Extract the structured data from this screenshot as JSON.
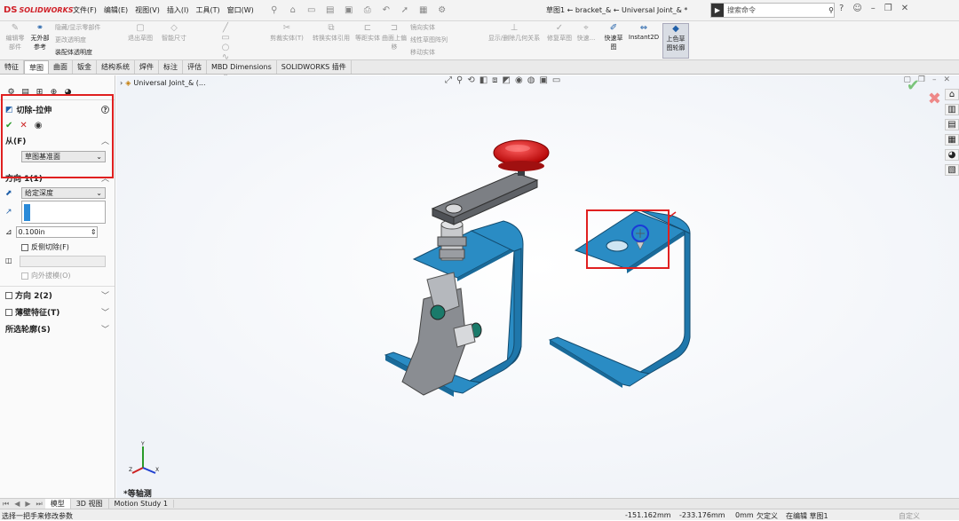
{
  "app": {
    "logo_mark": "DS",
    "logo_text": "SOLIDWORKS"
  },
  "menu": [
    "文件(F)",
    "编辑(E)",
    "视图(V)",
    "插入(I)",
    "工具(T)",
    "窗口(W)"
  ],
  "doc_title": "草图1 ← bracket_& ← Universal Joint_& *",
  "search": {
    "placeholder": "搜索命令"
  },
  "commands": {
    "edit_component": "编辑零部件",
    "no_external_refs": "无外部参考",
    "hide_show": "隐藏/显示零部件",
    "change_transparency": "更改透明度",
    "assembly_transparency": "装配体透明度",
    "exit_sketch": "退出草图",
    "smart_dimension": "智能尺寸",
    "trim_entities": "剪裁实体(T)",
    "convert_entities": "转换实体引用",
    "offset_entities": "等距实体",
    "surface_offset": "曲面上偏移",
    "mirror_entities": "镜向实体",
    "linear_pattern": "线性草图阵列",
    "move_entities": "移动实体",
    "display_relations": "显示/删除几何关系",
    "repair_sketch": "修复草图",
    "quick_snaps": "快速...",
    "rapid_sketch": "快速草图",
    "instant2d": "Instant2D",
    "shaded_contours": "上色草图轮廓"
  },
  "tabs": [
    "特征",
    "草图",
    "曲面",
    "钣金",
    "结构系统",
    "焊件",
    "标注",
    "评估",
    "MBD Dimensions",
    "SOLIDWORKS 插件"
  ],
  "active_tab": "草图",
  "property_manager": {
    "title": "切除-拉伸",
    "from_label": "从(F)",
    "from_value": "草图基准面",
    "direction1_label": "方向 1(1)",
    "end_condition": "给定深度",
    "depth": "0.100in",
    "flip_side": "反侧切除(F)",
    "draft_outward": "向外拔模(O)",
    "direction2_label": "方向 2(2)",
    "thin_feature_label": "薄壁特征(T)",
    "selected_contours_label": "所选轮廓(S)"
  },
  "tree": {
    "root": "Universal Joint_& (..."
  },
  "view": {
    "orientation_label": "*等轴测"
  },
  "bottom_tabs": [
    "模型",
    "3D 视图",
    "Motion Study 1"
  ],
  "status": {
    "message": "选择一把手来修改参数",
    "x": "-151.162mm",
    "y": "-233.176mm",
    "z": "0mm",
    "defined": "欠定义",
    "editing": "在编辑 草图1",
    "units": "自定义"
  },
  "colors": {
    "accent_red": "#e02020",
    "part_blue": "#2a8cc4",
    "knob_red": "#e01818"
  }
}
